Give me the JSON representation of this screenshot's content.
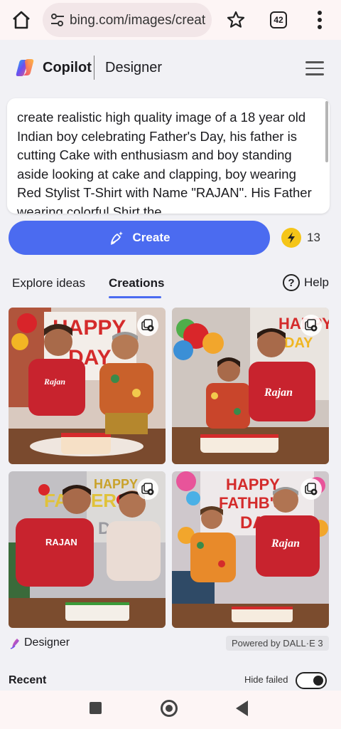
{
  "browser": {
    "url": "bing.com/images/create",
    "tab_count": "42",
    "icons": [
      "home-icon",
      "tune-icon",
      "star-icon",
      "tabs-icon",
      "more-vert-icon"
    ]
  },
  "header": {
    "brand": "Copilot",
    "product": "Designer"
  },
  "prompt": {
    "text": "create realistic high quality image of a 18 year old Indian boy celebrating Father's Day, his father is cutting Cake with enthusiasm and boy standing aside looking at cake and clapping, boy wearing Red Stylist T-Shirt with Name \"RAJAN\". His Father wearing colorful Shirt the"
  },
  "create": {
    "label": "Create",
    "boost_count": "13"
  },
  "tabs": [
    {
      "label": "Explore ideas",
      "active": false
    },
    {
      "label": "Creations",
      "active": true
    }
  ],
  "help_label": "Help",
  "images": [
    {
      "alt": "Generated image 1"
    },
    {
      "alt": "Generated image 2"
    },
    {
      "alt": "Generated image 3"
    },
    {
      "alt": "Generated image 4"
    }
  ],
  "footer": {
    "designer_label": "Designer",
    "powered_by": "Powered by DALL·E 3",
    "recent_label": "Recent",
    "hide_failed_label": "Hide failed",
    "hide_failed_on": true
  },
  "colors": {
    "accent": "#4b6bf0",
    "boost": "#f5c518",
    "shirt_red": "#c8232e"
  }
}
